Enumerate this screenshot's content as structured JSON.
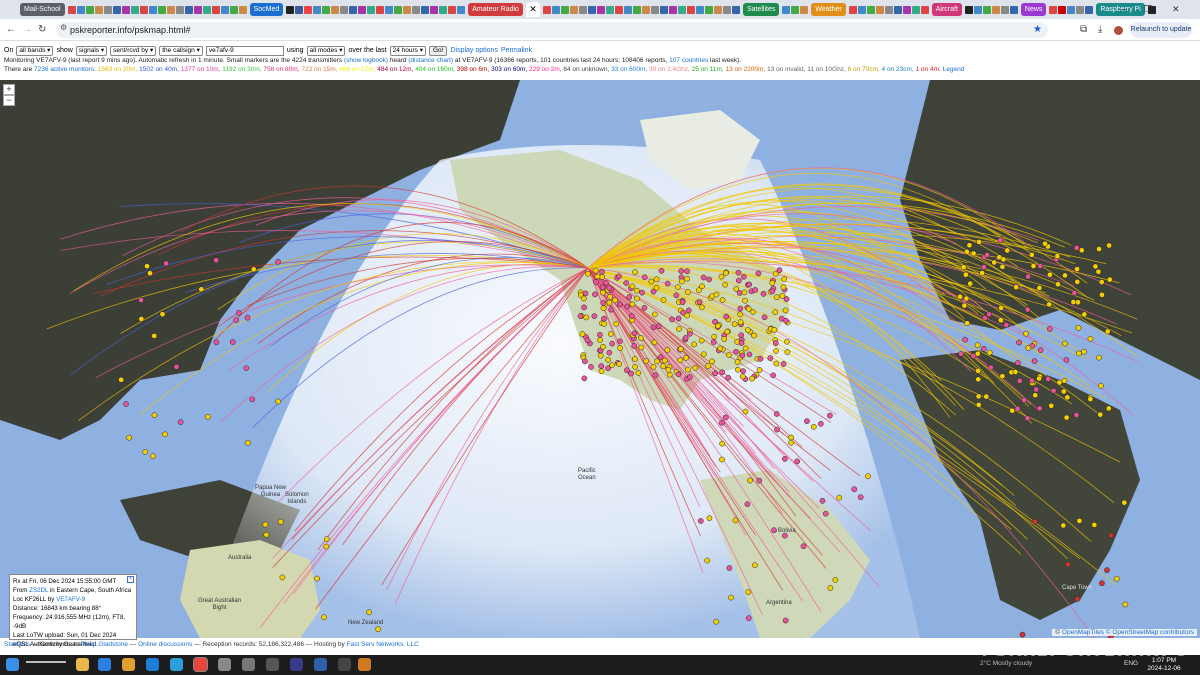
{
  "browser": {
    "tab_groups": [
      {
        "label": "Mail-School",
        "color": "#5a5f6a"
      },
      {
        "label": "SocMed",
        "color": "#1a6fd0"
      },
      {
        "label": "Amateur Radio",
        "color": "#d23b3b"
      },
      {
        "label": "Satellites",
        "color": "#1f8a4c"
      },
      {
        "label": "Weather",
        "color": "#e0901a"
      },
      {
        "label": "Aircraft",
        "color": "#d0367a"
      },
      {
        "label": "News",
        "color": "#9b3ad0"
      },
      {
        "label": "Raspberry Pi",
        "color": "#1a8a8a"
      }
    ],
    "active_tab_icon": "close-icon",
    "url": "pskreporter.info/pskmap.html#",
    "relaunch_label": "Relaunch to update",
    "window_controls": [
      "—",
      "❐",
      "✕"
    ]
  },
  "controls": {
    "on_label": "On",
    "band": "all bands",
    "show_label": "show",
    "what": "signals",
    "direction": "sent/rcvd by",
    "target": "the callsign",
    "callsign": "ve7afv-9",
    "using_label": "using",
    "mode": "all modes",
    "over_label": "over the last",
    "period": "24 hours",
    "go": "Go!",
    "display_options": "Display options",
    "permalink": "Permalink"
  },
  "monitor_line": {
    "prefix": "Monitoring VE7AFV-9 (last report 9 mins ago). Automatic refresh in 1 minute. Small markers are the 4224 transmitters",
    "logbook": "(show logbook)",
    "heard": "heard",
    "distance": "(distance chart)",
    "suffix": "at VE7AFV-9 (16366 reports, 101 countries last 24 hours; 108406 reports,",
    "countries": "107 countries",
    "end": "last week)."
  },
  "band_line": {
    "prefix": "There are",
    "monitors": "7236 active monitors:",
    "bands": [
      {
        "text": "1563 on 20m,",
        "color": "#e6b800"
      },
      {
        "text": "1502 on 40m,",
        "color": "#3355dd"
      },
      {
        "text": "1377 on 10m,",
        "color": "#e040a0"
      },
      {
        "text": "1192 on 30m,",
        "color": "#40c040"
      },
      {
        "text": "758 on 80m,",
        "color": "#e03070"
      },
      {
        "text": "723 on 15m,",
        "color": "#e08040"
      },
      {
        "text": "486 on 17m,",
        "color": "#f0f000"
      },
      {
        "text": "484 on 12m,",
        "color": "#b00040"
      },
      {
        "text": "404 on 160m,",
        "color": "#20c020"
      },
      {
        "text": "398 on 6m,",
        "color": "#c00000"
      },
      {
        "text": "303 on 60m,",
        "color": "#000080"
      },
      {
        "text": "229 on 2m,",
        "color": "#ff2090"
      },
      {
        "text": "64 on unknown,",
        "color": "#444444"
      },
      {
        "text": "33 on 600m,",
        "color": "#2080e0"
      },
      {
        "text": "30 on 2.4Ghz,",
        "color": "#f08080"
      },
      {
        "text": "25 on 11m,",
        "color": "#20b020"
      },
      {
        "text": "13 on 2200m,",
        "color": "#d06000"
      },
      {
        "text": "13 on invalid,",
        "color": "#666666"
      },
      {
        "text": "11 on 10Ghz,",
        "color": "#666666"
      },
      {
        "text": "6 on 70cm,",
        "color": "#c0a000"
      },
      {
        "text": "4 on 23cm,",
        "color": "#2080c0"
      },
      {
        "text": "1 on 4m.",
        "color": "#e02020"
      }
    ],
    "legend": "Legend"
  },
  "map": {
    "zoom_in": "+",
    "zoom_out": "−",
    "labels": {
      "pacific": "Pacific\nOcean",
      "solomon": "Solomon\nIslands",
      "guinea": "Papua New\nGuinea",
      "australia": "Australia",
      "great_bight": "Great Australian\nBight",
      "new_zealand": "New Zealand",
      "bolivia": "Bolivia",
      "argentina": "Argentina",
      "cape_town": "Cape Town"
    },
    "attribution": {
      "sep": "©",
      "a": "OpenMapTiles",
      "b": "© OpenStreetMap contributors"
    }
  },
  "popup": {
    "line1": "Rx at Fri, 06 Dec 2024 15:55:00 GMT",
    "from": "From",
    "from_call": "ZS2DL",
    "from_loc": "in Eastern Cape, South Africa",
    "loc_label": "Loc KF26LL by",
    "loc_call": "VE7AFV-9",
    "distance": "Distance: 16843 km bearing 88°",
    "frequency": "Frequency: 24.916,555 MHz (12m), FT8, -9dB",
    "lotw": "Last LoTW upload: Sun, 01 Dec 2024",
    "eqsl": "eQSL Authenticity Guaranteed."
  },
  "footer": {
    "statistics": "Statistics",
    "comments": "— Comments to",
    "author": "Philip Gladstone",
    "dash": "—",
    "discussions": "Online discussions",
    "records": "— Reception records: 52,186,322,486 — Hosting by",
    "host": "Fast Serv Networks, LLC"
  },
  "watermark": "PSKREPORTER.INFO",
  "taskbar": {
    "weather": "2°C Mostly cloudy",
    "lang": "ENG",
    "time": "1:07 PM",
    "date": "2024-12-06"
  },
  "colors": {
    "line_yellow": "#f2c800",
    "line_pink": "#ef5f9a",
    "line_red": "#d2352f",
    "line_blue": "#4a63e0",
    "marker_yellow": "#f5d000",
    "marker_pink": "#e8549a"
  }
}
